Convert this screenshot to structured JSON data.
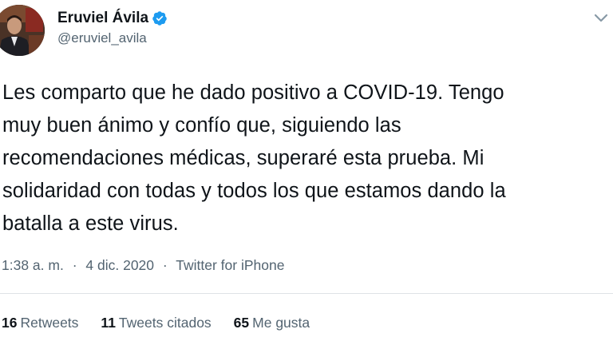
{
  "author": {
    "name": "Eruviel Ávila",
    "handle": "@eruviel_avila"
  },
  "tweet": {
    "lines": [
      "Les comparto que he dado positivo a COVID-19. Tengo",
      "muy buen ánimo y confío que, siguiendo las",
      "recomendaciones médicas, superaré esta prueba. Mi",
      "solidaridad con todas y todos los que estamos dando la",
      "batalla a este virus."
    ],
    "time": "1:38 a. m.",
    "date": "4 dic. 2020",
    "separator": "·",
    "source": "Twitter for iPhone"
  },
  "stats": {
    "retweets": {
      "count": "16",
      "label": "Retweets"
    },
    "quotes": {
      "count": "11",
      "label": "Tweets citados"
    },
    "likes": {
      "count": "65",
      "label": "Me gusta"
    }
  },
  "icons": {
    "verified": "verified-badge-icon",
    "more": "chevron-down-icon"
  },
  "colors": {
    "verified": "#1d9bf0",
    "secondary_text": "#536471",
    "primary_text": "#0f1419",
    "divider": "#dfe3e6"
  }
}
